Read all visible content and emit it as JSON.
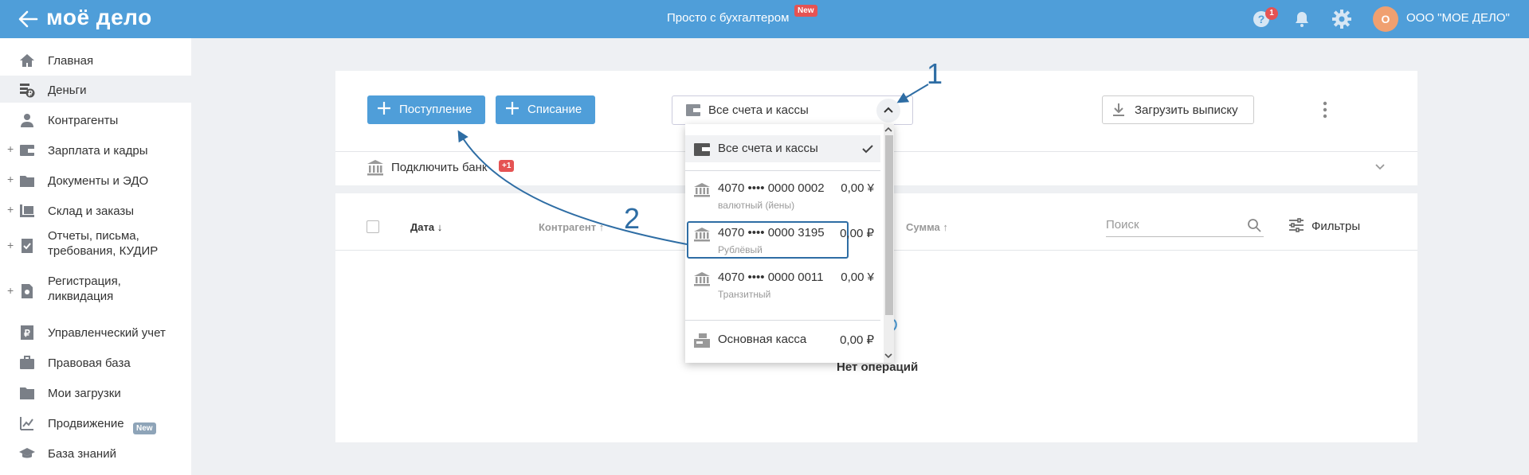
{
  "header": {
    "logo": "моё дело",
    "center_title": "Просто с бухгалтером",
    "center_badge": "New",
    "help_badge": "1",
    "avatar_letter": "О",
    "company": "ООО \"МОЕ ДЕЛО\""
  },
  "sidebar": {
    "items": [
      {
        "label": "Главная",
        "icon": "home-icon"
      },
      {
        "label": "Деньги",
        "icon": "money-icon"
      },
      {
        "label": "Контрагенты",
        "icon": "contractors-icon"
      },
      {
        "label": "Зарплата и кадры",
        "icon": "salary-icon"
      },
      {
        "label": "Документы и ЭДО",
        "icon": "documents-icon"
      },
      {
        "label": "Склад и заказы",
        "icon": "warehouse-icon"
      },
      {
        "label": "Отчеты, письма, требования, КУДИР",
        "icon": "reports-icon"
      },
      {
        "label": "Регистрация, ликвидация",
        "icon": "registration-icon"
      },
      {
        "label": "Управленческий учет",
        "icon": "management-icon"
      },
      {
        "label": "Правовая база",
        "icon": "briefcase-icon"
      },
      {
        "label": "Мои загрузки",
        "icon": "folder-icon"
      },
      {
        "label": "Продвижение",
        "icon": "promotion-icon"
      },
      {
        "label": "База знаний",
        "icon": "knowledge-icon"
      }
    ],
    "promotion_badge": "New"
  },
  "toolbar": {
    "income_label": "Поступление",
    "expense_label": "Списание",
    "accounts_select": "Все счета и кассы",
    "upload_label": "Загрузить выписку"
  },
  "bank": {
    "label": "Подключить банк",
    "badge": "+1"
  },
  "table": {
    "col_date": "Дата ↓",
    "col_contractor": "Контрагент ↑",
    "col_sum": "Сумма ↑",
    "search_placeholder": "Поиск",
    "filters_label": "Фильтры",
    "empty_text": "Нет операций"
  },
  "dropdown": {
    "all_label": "Все счета и кассы",
    "accounts": [
      {
        "number": "4070 •••• 0000 0002",
        "amount": "0,00 ¥",
        "subtitle": "валютный (йены)"
      },
      {
        "number": "4070 •••• 0000 3195",
        "amount": "0,00 ₽",
        "subtitle": "Рублёвый"
      },
      {
        "number": "4070 •••• 0000 0011",
        "amount": "0,00 ¥",
        "subtitle": "Транзитный"
      }
    ],
    "cash_label": "Основная касса",
    "cash_amount": "0,00 ₽"
  },
  "annotations": {
    "one": "1",
    "two": "2"
  },
  "colors": {
    "header_bg": "#4f9ed9",
    "annotation": "#2e6da4",
    "badge": "#e55353"
  }
}
